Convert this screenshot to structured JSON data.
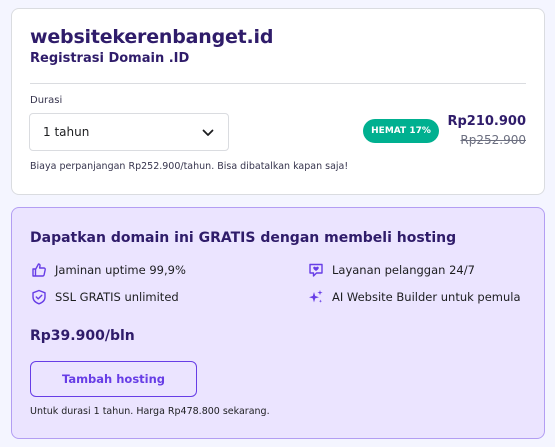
{
  "domain": {
    "name": "websitekerenbanget.id",
    "subtitle": "Registrasi Domain .ID"
  },
  "duration": {
    "label": "Durasi",
    "selected": "1 tahun"
  },
  "pricing": {
    "badge": "HEMAT 17%",
    "current_price": "Rp210.900",
    "original_price": "Rp252.900",
    "renewal_note": "Biaya perpanjangan Rp252.900/tahun. Bisa dibatalkan kapan saja!"
  },
  "promo": {
    "title": "Dapatkan domain ini GRATIS dengan membeli hosting",
    "features": [
      {
        "label": "Jaminan uptime 99,9%",
        "icon": "thumbs-up-icon"
      },
      {
        "label": "Layanan pelanggan 24/7",
        "icon": "chat-support-icon"
      },
      {
        "label": "SSL GRATIS unlimited",
        "icon": "shield-check-icon"
      },
      {
        "label": "AI Website Builder untuk pemula",
        "icon": "sparkles-icon"
      }
    ],
    "price": "Rp39.900/bln",
    "button_label": "Tambah hosting",
    "footnote": "Untuk durasi 1 tahun. Harga Rp478.800 sekarang."
  },
  "colors": {
    "primary": "#673de6",
    "heading": "#2f1c6a",
    "badge": "#00b090",
    "promo_bg": "#ebe4ff",
    "promo_border": "#b39ef3"
  }
}
